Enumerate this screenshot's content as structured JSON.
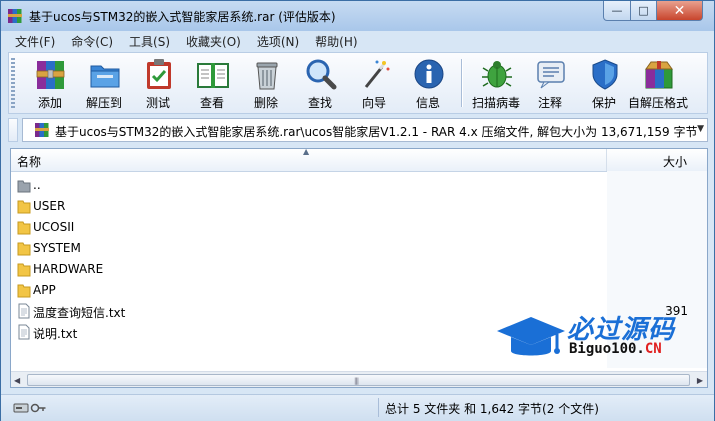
{
  "window": {
    "title": "基于ucos与STM32的嵌入式智能家居系统.rar (评估版本)",
    "minimize_glyph": "—",
    "maximize_glyph": "□",
    "close_glyph": "✕"
  },
  "menu": {
    "items": [
      "文件(F)",
      "命令(C)",
      "工具(S)",
      "收藏夹(O)",
      "选项(N)",
      "帮助(H)"
    ]
  },
  "toolbar": {
    "tools": [
      {
        "label": "添加",
        "icon": "add-archive-icon"
      },
      {
        "label": "解压到",
        "icon": "extract-folder-icon"
      },
      {
        "label": "测试",
        "icon": "test-clipboard-icon"
      },
      {
        "label": "查看",
        "icon": "view-book-icon"
      },
      {
        "label": "删除",
        "icon": "trash-icon"
      },
      {
        "label": "查找",
        "icon": "magnifier-icon"
      },
      {
        "label": "向导",
        "icon": "wizard-wand-icon"
      },
      {
        "label": "信息",
        "icon": "info-icon"
      },
      {
        "label": "扫描病毒",
        "icon": "bug-icon"
      },
      {
        "label": "注释",
        "icon": "comment-icon"
      },
      {
        "label": "保护",
        "icon": "shield-icon"
      },
      {
        "label": "自解压格式",
        "icon": "sfx-box-icon"
      }
    ]
  },
  "address": {
    "path": "基于ucos与STM32的嵌入式智能家居系统.rar\\ucos智能家居V1.2.1 - RAR 4.x 压缩文件, 解包大小为 13,671,159 字节"
  },
  "filelist": {
    "col_name": "名称",
    "col_size": "大小",
    "rows": [
      {
        "name": "..",
        "type": "up",
        "size": ""
      },
      {
        "name": "USER",
        "type": "folder",
        "size": ""
      },
      {
        "name": "UCOSII",
        "type": "folder",
        "size": ""
      },
      {
        "name": "SYSTEM",
        "type": "folder",
        "size": ""
      },
      {
        "name": "HARDWARE",
        "type": "folder",
        "size": ""
      },
      {
        "name": "APP",
        "type": "folder",
        "size": ""
      },
      {
        "name": "温度查询短信.txt",
        "type": "file",
        "size": "391"
      },
      {
        "name": "说明.txt",
        "type": "file",
        "size": ""
      }
    ]
  },
  "status": {
    "summary": "总计 5 文件夹 和 1,642 字节(2 个文件)"
  },
  "watermark": {
    "cn": "必过源码",
    "en_prefix": "Biguo100.",
    "en_suffix": "CN"
  },
  "colors": {
    "folder": "#f2c545",
    "accent": "#1a6fd6",
    "close": "#c8452d"
  }
}
